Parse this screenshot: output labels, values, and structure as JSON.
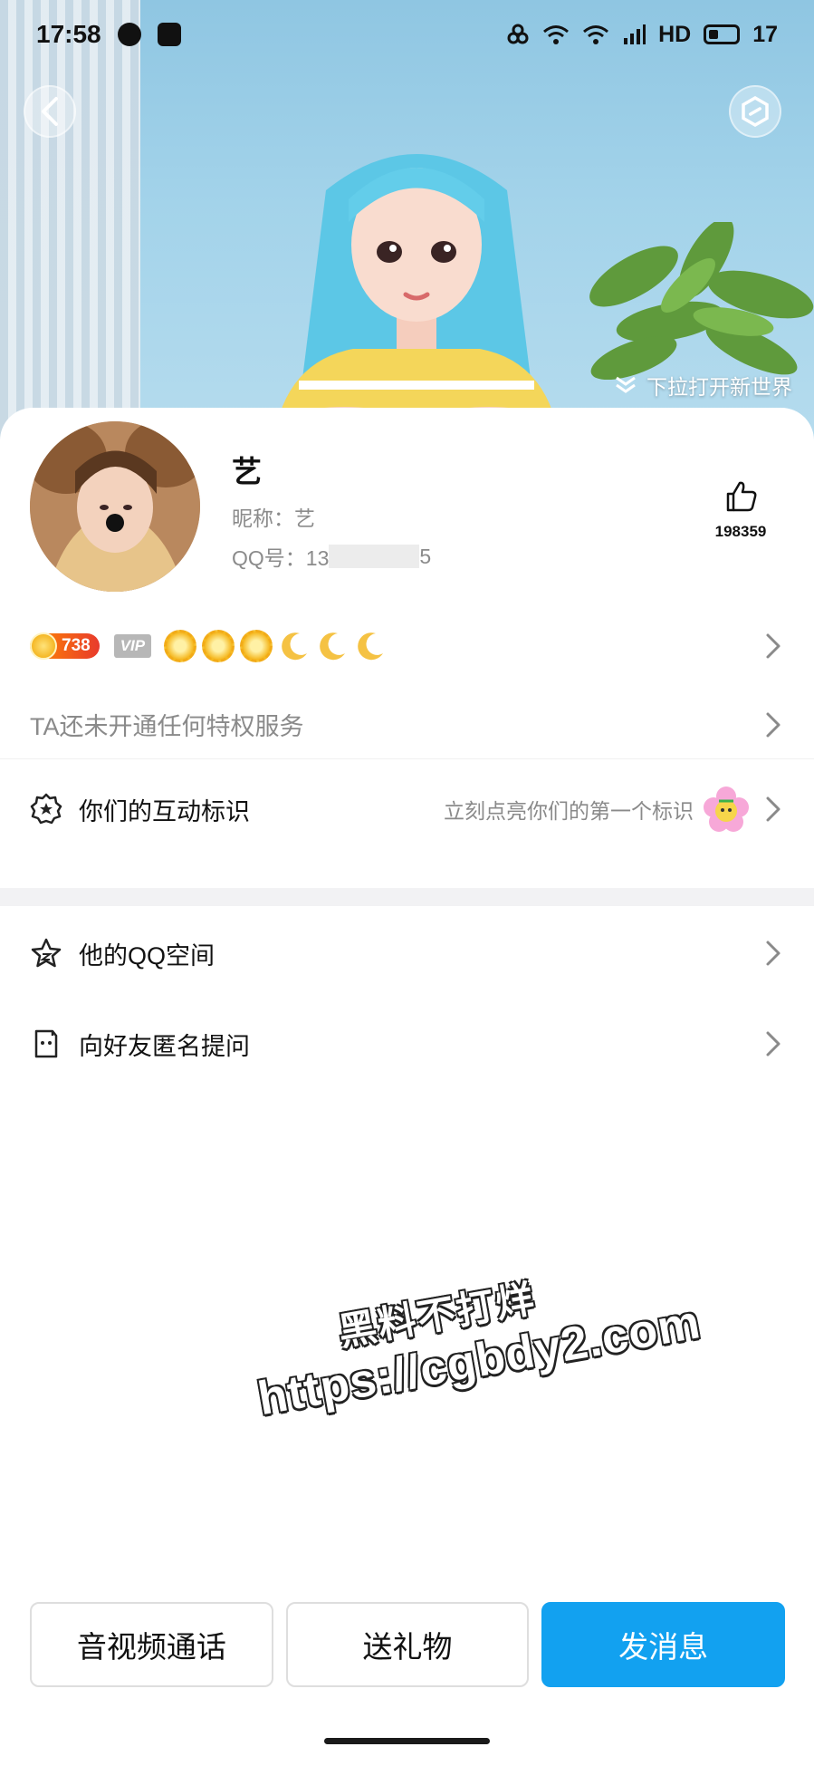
{
  "status_bar": {
    "time": "17:58",
    "right_text": "HD",
    "battery": "17"
  },
  "header": {
    "pull_hint": "下拉打开新世界"
  },
  "profile": {
    "name": "艺",
    "nickname": "昵称：艺",
    "qq_prefix": "QQ号：13",
    "qq_suffix": "5",
    "likes": "198359"
  },
  "level": {
    "badge_number": "738",
    "vip_label": "VIP"
  },
  "privilege": {
    "text": "TA还未开通任何特权服务"
  },
  "interaction": {
    "label": "你们的互动标识",
    "hint": "立刻点亮你们的第一个标识"
  },
  "menu": {
    "qzone": "他的QQ空间",
    "ask": "向好友匿名提问"
  },
  "watermark": {
    "line1": "黑料不打烊",
    "line2": "https://cgbdy2.com"
  },
  "actions": {
    "call": "音视频通话",
    "gift": "送礼物",
    "message": "发消息"
  },
  "colors": {
    "primary": "#12a1f0",
    "muted_text": "#8a8a8a"
  }
}
